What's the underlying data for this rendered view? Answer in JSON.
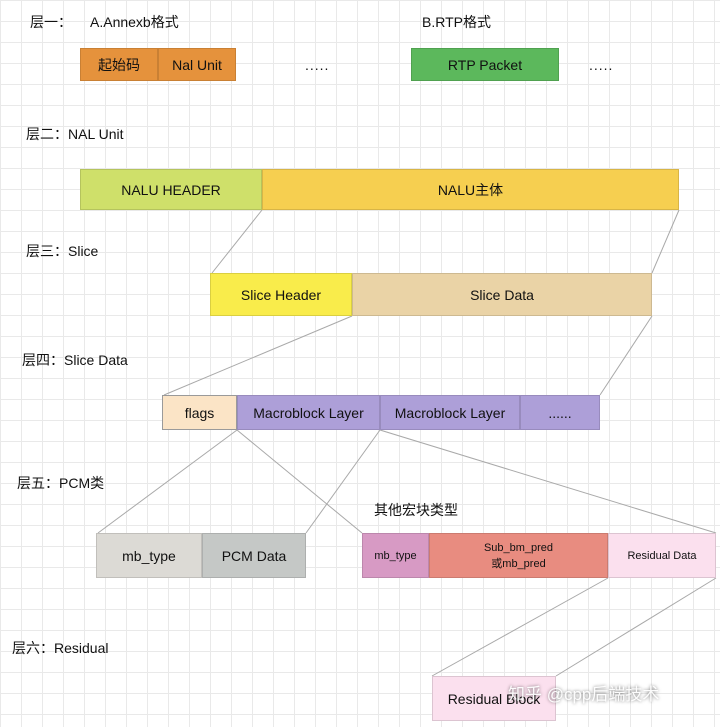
{
  "layer1": {
    "label": "层一：",
    "annexb_title": "A.Annexb格式",
    "rtp_title": "B.RTP格式",
    "start_code": "起始码",
    "nal_unit": "Nal Unit",
    "dots1": ".....",
    "rtp_packet": "RTP Packet",
    "dots2": "....."
  },
  "layer2": {
    "label": "层二：NAL Unit",
    "nalu_header": "NALU HEADER",
    "nalu_body": "NALU主体"
  },
  "layer3": {
    "label": "层三：Slice",
    "slice_header": "Slice Header",
    "slice_data": "Slice Data"
  },
  "layer4": {
    "label": "层四：Slice Data",
    "flags": "flags",
    "macroblock_1": "Macroblock Layer",
    "macroblock_2": "Macroblock Layer",
    "dots": "......"
  },
  "layer5": {
    "label": "层五：PCM类",
    "other_title": "其他宏块类型",
    "mb_type": "mb_type",
    "pcm_data": "PCM Data",
    "mb_type_small": "mb_type",
    "sub_pred_line1": "Sub_bm_pred",
    "sub_pred_line2": "或mb_pred",
    "residual_data": "Residual Data"
  },
  "layer6": {
    "label": "层六：Residual",
    "residual_block": "Residual Block"
  },
  "watermark": "知乎 @cpp后端技术",
  "colors": {
    "orange": "#e5923c",
    "green": "#5cb85c",
    "lime": "#cfe06a",
    "gold": "#f6cf50",
    "yellow": "#f9ec4b",
    "tan": "#ead3a6",
    "cream": "#fbe4c6",
    "purple": "#ad9fd8",
    "gray": "#dcdad5",
    "darkgray": "#c5c8c6",
    "pink": "#d79ac4",
    "salmon": "#e88c80",
    "lightpink": "#fbe0ee"
  }
}
